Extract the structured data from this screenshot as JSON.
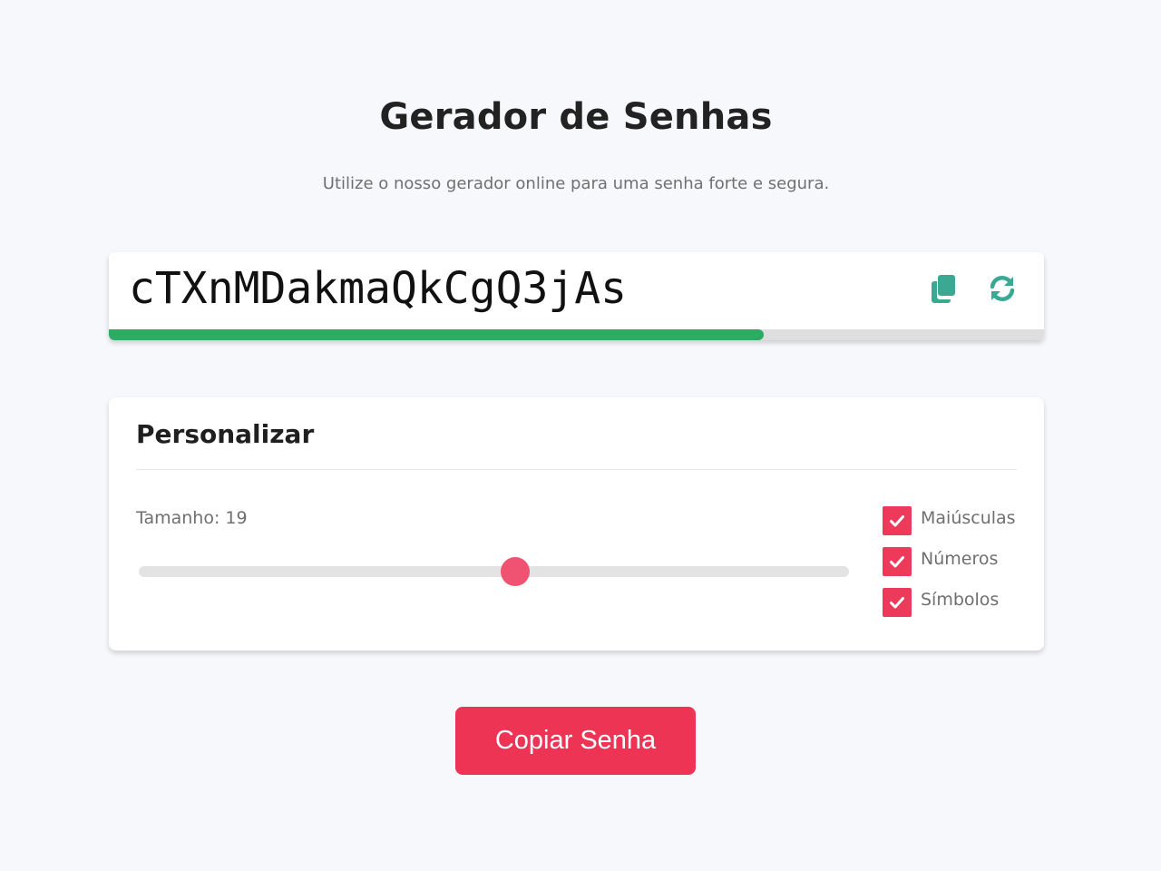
{
  "header": {
    "title": "Gerador de Senhas",
    "subtitle": "Utilize o nosso gerador online para uma senha forte e segura."
  },
  "password": {
    "value": "cTXnMDakmaQkCgQ3jAs",
    "copy_icon": "copy-icon",
    "refresh_icon": "refresh-icon",
    "strength_fraction": 0.7
  },
  "customize": {
    "title": "Personalizar",
    "size_label": "Tamanho: 19",
    "slider_fraction": 0.53,
    "options": [
      {
        "label": "Maiúsculas",
        "checked": true
      },
      {
        "label": "Números",
        "checked": true
      },
      {
        "label": "Símbolos",
        "checked": true
      }
    ]
  },
  "copy_button": {
    "label": "Copiar Senha"
  },
  "colors": {
    "accent": "#ee3455",
    "strength": "#2aad62",
    "icon": "#3aa892"
  }
}
